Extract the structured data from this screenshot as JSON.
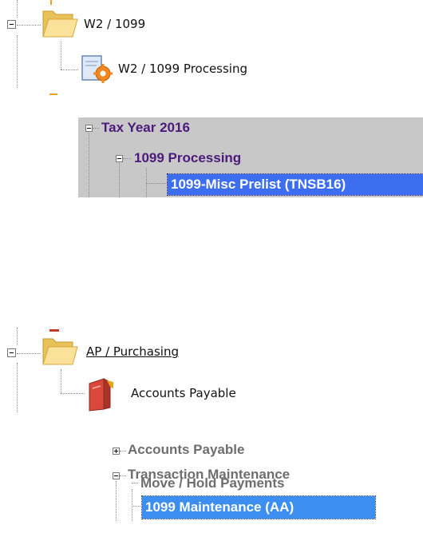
{
  "tree1": {
    "folder_label": "W2 / 1099",
    "child_label": "W2 / 1099 Processing"
  },
  "tree2": {
    "year_label": "Tax Year 2016",
    "group_label": "1099 Processing",
    "selected_label": "1099-Misc Prelist (TNSB16)"
  },
  "tree3": {
    "folder_label": "AP / Purchasing",
    "child_label": "Accounts Payable"
  },
  "tree4": {
    "item1_label": "Accounts Payable",
    "item2_label": "Transaction Maintenance",
    "item3_label": "Move / Hold Payments",
    "selected_label": "1099 Maintenance (AA)"
  },
  "colors": {
    "tree2_text": "#4b1a7a",
    "tree2_panel": "#c8c8c8",
    "selection": "#3d6ef0",
    "tree4_text": "#6e6e6e"
  }
}
